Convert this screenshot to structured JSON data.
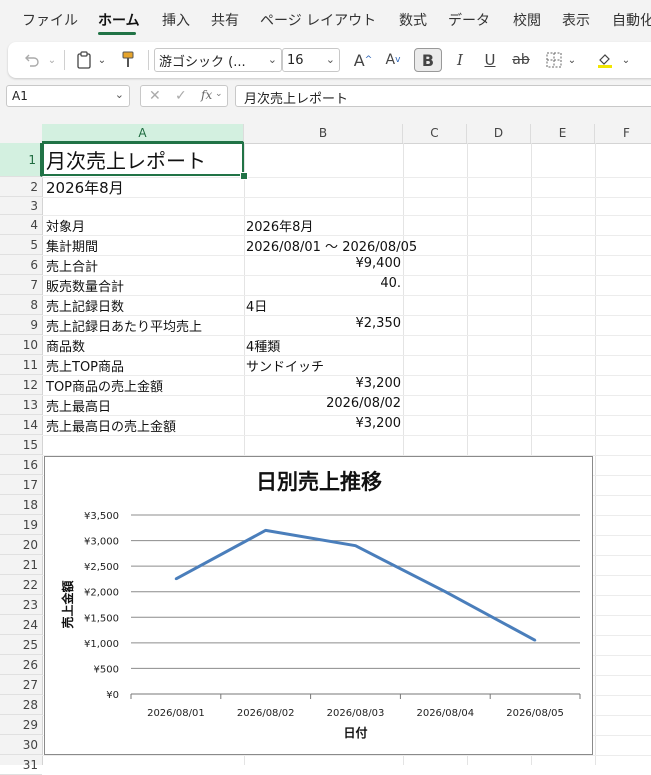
{
  "menu": {
    "tabs": [
      "ファイル",
      "ホーム",
      "挿入",
      "共有",
      "ページ レイアウト",
      "数式",
      "データ",
      "校閲",
      "表示",
      "自動化"
    ],
    "active": "ホーム"
  },
  "ribbon": {
    "font_name": "游ゴシック (...",
    "font_size": "16",
    "bold_label": "B",
    "italic_label": "I",
    "underline_label": "U",
    "strike_label": "ab",
    "grow_font_label": "A",
    "shrink_font_label": "A",
    "accent_color": "#217346"
  },
  "formula_bar": {
    "name_box": "A1",
    "fx_label": "fx",
    "formula": "月次売上レポート"
  },
  "columns": [
    "A",
    "B",
    "C",
    "D",
    "E",
    "F"
  ],
  "selected_column": "A",
  "rows": [
    "1",
    "2",
    "3",
    "4",
    "5",
    "6",
    "7",
    "8",
    "9",
    "10",
    "11",
    "12",
    "13",
    "14",
    "15",
    "16",
    "17",
    "18",
    "19",
    "20",
    "21",
    "22",
    "23",
    "24",
    "25",
    "26",
    "27",
    "28",
    "29",
    "30",
    "31"
  ],
  "selected_row": "1",
  "sheet": {
    "title": "月次売上レポート",
    "subtitle": "2026年8月",
    "table": [
      {
        "label": "対象月",
        "value": "2026年8月",
        "align": "left"
      },
      {
        "label": "集計期間",
        "value": "2026/08/01 〜 2026/08/05",
        "align": "left"
      },
      {
        "label": "売上合計",
        "value": "¥9,400",
        "align": "right"
      },
      {
        "label": "販売数量合計",
        "value": "40.",
        "align": "right"
      },
      {
        "label": "売上記録日数",
        "value": "4日",
        "align": "left"
      },
      {
        "label": "売上記録日あたり平均売上",
        "value": "¥2,350",
        "align": "right"
      },
      {
        "label": "商品数",
        "value": "4種類",
        "align": "left"
      },
      {
        "label": "売上TOP商品",
        "value": "サンドイッチ",
        "align": "left"
      },
      {
        "label": "TOP商品の売上金額",
        "value": "¥3,200",
        "align": "right"
      },
      {
        "label": "売上最高日",
        "value": "2026/08/02",
        "align": "right"
      },
      {
        "label": "売上最高日の売上金額",
        "value": "¥3,200",
        "align": "right"
      }
    ]
  },
  "chart_data": {
    "type": "line",
    "title": "日別売上推移",
    "xlabel": "日付",
    "ylabel": "売上金額",
    "categories": [
      "2026/08/01",
      "2026/08/02",
      "2026/08/03",
      "2026/08/04",
      "2026/08/05"
    ],
    "series": [
      {
        "values": [
          2250,
          3200,
          2900,
          2000,
          1050
        ],
        "color": "#4a7ebb"
      }
    ],
    "yticks": [
      "¥0",
      "¥500",
      "¥1,000",
      "¥1,500",
      "¥2,000",
      "¥2,500",
      "¥3,000",
      "¥3,500"
    ],
    "ylim": [
      0,
      3500
    ],
    "grid": true,
    "legend": "none"
  }
}
